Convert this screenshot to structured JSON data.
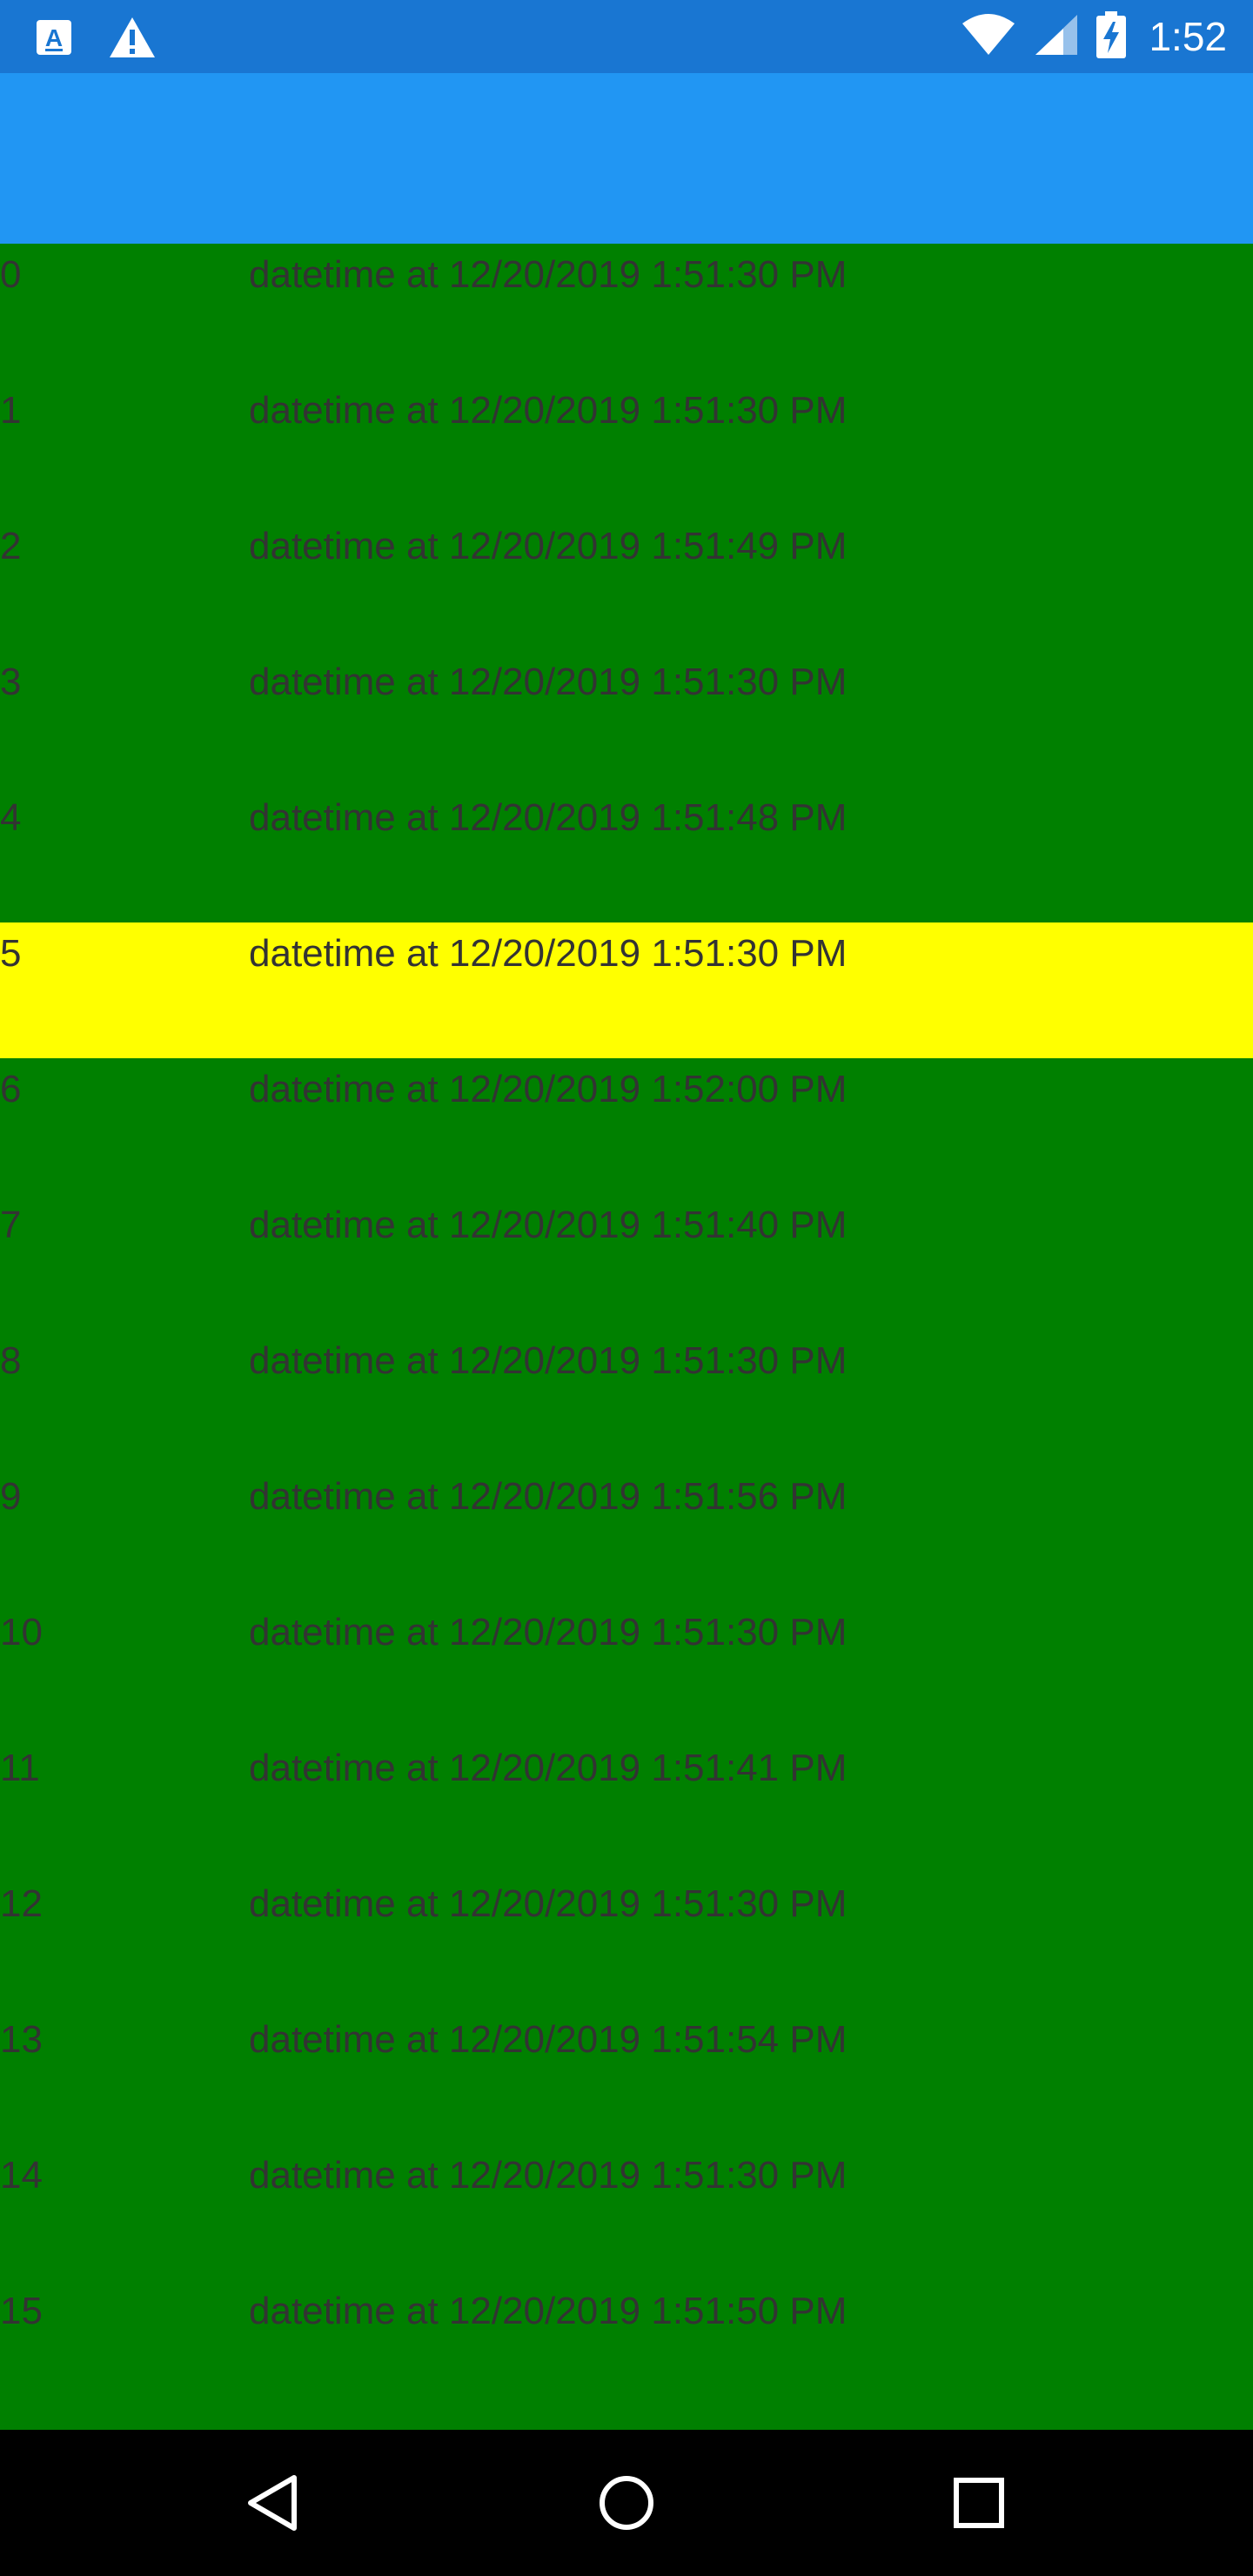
{
  "status_bar": {
    "time": "1:52",
    "icons_left": [
      "app-a-icon",
      "warning-icon"
    ],
    "icons_right": [
      "wifi-icon",
      "signal-icon",
      "battery-charging-icon"
    ],
    "color": "#1976D2"
  },
  "app_bar": {
    "color": "#2196F3"
  },
  "list": {
    "background": "#008000",
    "highlight_color": "#FFFF00",
    "items": [
      {
        "index": "0",
        "text": "datetime at 12/20/2019 1:51:30 PM",
        "highlighted": false
      },
      {
        "index": "1",
        "text": "datetime at 12/20/2019 1:51:30 PM",
        "highlighted": false
      },
      {
        "index": "2",
        "text": "datetime at 12/20/2019 1:51:49 PM",
        "highlighted": false
      },
      {
        "index": "3",
        "text": "datetime at 12/20/2019 1:51:30 PM",
        "highlighted": false
      },
      {
        "index": "4",
        "text": "datetime at 12/20/2019 1:51:48 PM",
        "highlighted": false
      },
      {
        "index": "5",
        "text": "datetime at 12/20/2019 1:51:30 PM",
        "highlighted": true
      },
      {
        "index": "6",
        "text": "datetime at 12/20/2019 1:52:00 PM",
        "highlighted": false
      },
      {
        "index": "7",
        "text": "datetime at 12/20/2019 1:51:40 PM",
        "highlighted": false
      },
      {
        "index": "8",
        "text": "datetime at 12/20/2019 1:51:30 PM",
        "highlighted": false
      },
      {
        "index": "9",
        "text": "datetime at 12/20/2019 1:51:56 PM",
        "highlighted": false
      },
      {
        "index": "10",
        "text": "datetime at 12/20/2019 1:51:30 PM",
        "highlighted": false
      },
      {
        "index": "11",
        "text": "datetime at 12/20/2019 1:51:41 PM",
        "highlighted": false
      },
      {
        "index": "12",
        "text": "datetime at 12/20/2019 1:51:30 PM",
        "highlighted": false
      },
      {
        "index": "13",
        "text": "datetime at 12/20/2019 1:51:54 PM",
        "highlighted": false
      },
      {
        "index": "14",
        "text": "datetime at 12/20/2019 1:51:30 PM",
        "highlighted": false
      },
      {
        "index": "15",
        "text": "datetime at 12/20/2019 1:51:50 PM",
        "highlighted": false
      }
    ]
  },
  "nav_bar": {
    "buttons": [
      "back-icon",
      "home-icon",
      "recents-icon"
    ]
  }
}
